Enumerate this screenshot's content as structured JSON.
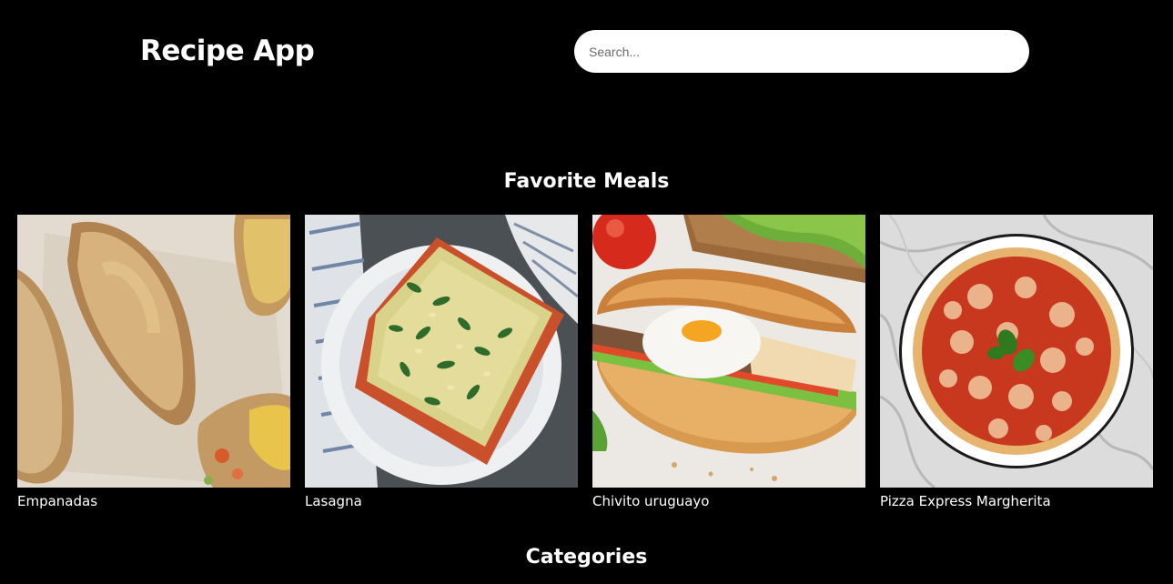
{
  "header": {
    "title": "Recipe App",
    "search_placeholder": "Search..."
  },
  "favorites": {
    "title": "Favorite Meals",
    "meals": [
      {
        "name": "Empanadas"
      },
      {
        "name": "Lasagna"
      },
      {
        "name": "Chivito uruguayo"
      },
      {
        "name": "Pizza Express Margherita"
      }
    ]
  },
  "categories": {
    "title": "Categories"
  }
}
